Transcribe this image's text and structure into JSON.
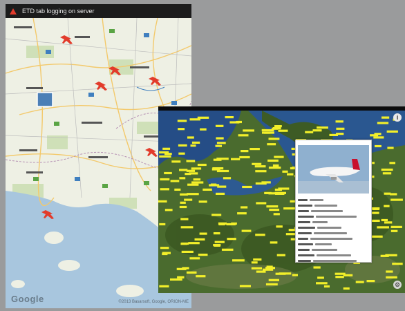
{
  "phone": {
    "status_text": "ETD tab logging on server",
    "map_branding": "Google",
    "map_copyright": "©2013 Basarsoft, Google, ORION-ME",
    "colors": {
      "statusbar": "#1c1c1c",
      "land": "#eef0e4",
      "sea": "#a8c6de",
      "plane": "#e23b2b"
    }
  },
  "tablet": {
    "info_icon": "i",
    "settings_icon": "⚙",
    "colors": {
      "labels": "#f2ef2a",
      "sea": "#254d86",
      "land": "#4a6b2e"
    },
    "flight_popup": {
      "header": "",
      "rows": 12
    }
  }
}
